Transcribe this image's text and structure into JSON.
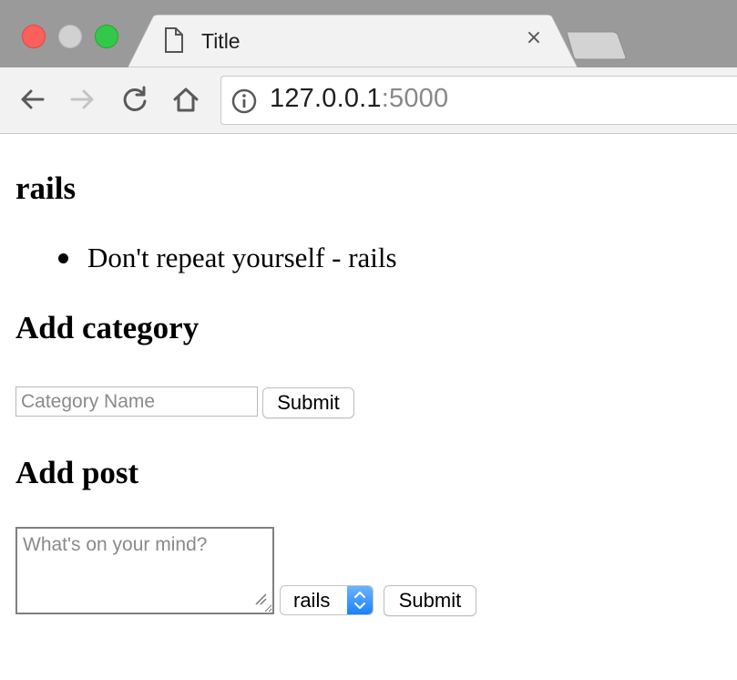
{
  "browser": {
    "tab_title": "Title",
    "tab_close_glyph": "×",
    "url_host": "127.0.0.1",
    "url_port": ":5000",
    "icons": [
      "back-arrow-icon",
      "forward-arrow-icon",
      "reload-icon",
      "home-icon",
      "info-icon",
      "document-icon",
      "close-icon"
    ]
  },
  "page": {
    "category_heading": "rails",
    "posts": [
      {
        "text": "Don't repeat yourself - rails"
      }
    ],
    "add_category": {
      "heading": "Add category",
      "input_placeholder": "Category Name",
      "submit_label": "Submit"
    },
    "add_post": {
      "heading": "Add post",
      "textarea_placeholder": "What's on your mind?",
      "category_selected": "rails",
      "submit_label": "Submit"
    }
  },
  "colors": {
    "close_red": "#fc605c",
    "minimize_grey": "#d1d1d1",
    "zoom_green": "#34c84a",
    "select_accent": "#1a82fb"
  }
}
